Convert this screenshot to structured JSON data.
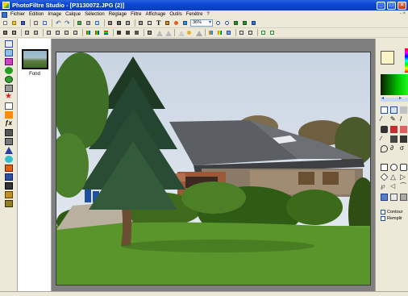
{
  "window": {
    "title": "PhotoFiltre Studio - [P3130072.JPG (2)]",
    "minimize": "_",
    "maximize": "□",
    "close": "×"
  },
  "menu": {
    "items": [
      "Fichier",
      "Edition",
      "Image",
      "Calque",
      "Sélection",
      "Réglage",
      "Filtre",
      "Affichage",
      "Outils",
      "Fenêtre",
      "?"
    ],
    "right_glyph": "- ×"
  },
  "toolbar": {
    "zoom_value": "36%"
  },
  "thumbnails": [
    {
      "label": "Fond"
    }
  ],
  "right_panel": {
    "contour_label": "Contour",
    "remplir_label": "Remplir"
  },
  "colors": {
    "foreground": "#fcf3c7",
    "selected_swatch": "#00c000",
    "titlebar": "#0a46d4",
    "workspace": "#7f7f7f"
  }
}
